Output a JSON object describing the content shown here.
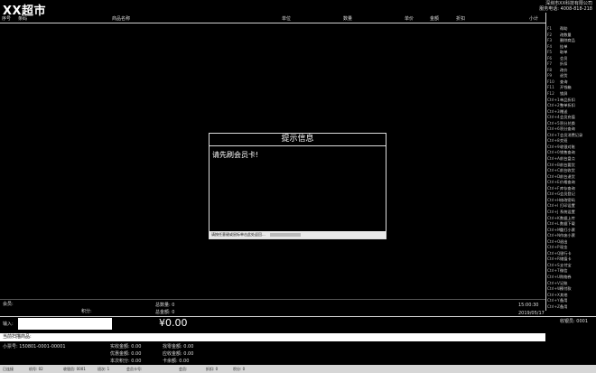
{
  "header": {
    "store_name": "XX超市",
    "company_line1": "深圳市XX科技有限公司",
    "company_line2": "服务电话: 4008-818-218"
  },
  "columns": [
    "序号",
    "条码",
    "商品名称",
    "单位",
    "数量",
    "单价",
    "金额",
    "折扣",
    "小计"
  ],
  "function_keys": [
    {
      "key": "F1",
      "label": "帮助"
    },
    {
      "key": "F2",
      "label": "改数量"
    },
    {
      "key": "F3",
      "label": "删除商品"
    },
    {
      "key": "F4",
      "label": "挂单"
    },
    {
      "key": "F5",
      "label": "取单"
    },
    {
      "key": "F6",
      "label": "会员"
    },
    {
      "key": "F7",
      "label": "折扣"
    },
    {
      "key": "F8",
      "label": "改价"
    },
    {
      "key": "F9",
      "label": "退货"
    },
    {
      "key": "F10",
      "label": "查询"
    },
    {
      "key": "F11",
      "label": "开钱箱"
    },
    {
      "key": "F12",
      "label": "锁屏"
    },
    {
      "key": "Ctrl+1",
      "label": "单品折扣"
    },
    {
      "key": "Ctrl+2",
      "label": "整单折扣"
    },
    {
      "key": "Ctrl+3",
      "label": "赠送"
    },
    {
      "key": "Ctrl+4",
      "label": "会员充值"
    },
    {
      "key": "Ctrl+5",
      "label": "积分兑换"
    },
    {
      "key": "Ctrl+6",
      "label": "积分查询"
    },
    {
      "key": "Ctrl+7",
      "label": "会员消费记录"
    },
    {
      "key": "Ctrl+8",
      "label": "交班"
    },
    {
      "key": "Ctrl+9",
      "label": "收银对账"
    },
    {
      "key": "Ctrl+0",
      "label": "销售查询"
    },
    {
      "key": "Ctrl+A",
      "label": "前台盘点"
    },
    {
      "key": "Ctrl+B",
      "label": "前台要货"
    },
    {
      "key": "Ctrl+C",
      "label": "前台收货"
    },
    {
      "key": "Ctrl+D",
      "label": "前台退货"
    },
    {
      "key": "Ctrl+E",
      "label": "价格查询"
    },
    {
      "key": "Ctrl+F",
      "label": "库存查询"
    },
    {
      "key": "Ctrl+G",
      "label": "会员登记"
    },
    {
      "key": "Ctrl+H",
      "label": "修改密码"
    },
    {
      "key": "Ctrl+I",
      "label": "打印设置"
    },
    {
      "key": "Ctrl+J",
      "label": "系统设置"
    },
    {
      "key": "Ctrl+K",
      "label": "数据上传"
    },
    {
      "key": "Ctrl+L",
      "label": "数据下载"
    },
    {
      "key": "Ctrl+M",
      "label": "重打小票"
    },
    {
      "key": "Ctrl+N",
      "label": "作废小票"
    },
    {
      "key": "Ctrl+O",
      "label": "退出"
    },
    {
      "key": "Ctrl+P",
      "label": "现金"
    },
    {
      "key": "Ctrl+Q",
      "label": "银行卡"
    },
    {
      "key": "Ctrl+R",
      "label": "储值卡"
    },
    {
      "key": "Ctrl+S",
      "label": "支付宝"
    },
    {
      "key": "Ctrl+T",
      "label": "微信"
    },
    {
      "key": "Ctrl+U",
      "label": "购物券"
    },
    {
      "key": "Ctrl+V",
      "label": "记账"
    },
    {
      "key": "Ctrl+W",
      "label": "预付款"
    },
    {
      "key": "Ctrl+X",
      "label": "其他"
    },
    {
      "key": "Ctrl+Y",
      "label": "备用"
    },
    {
      "key": "Ctrl+Z",
      "label": "备用"
    }
  ],
  "dialog": {
    "title": "提示信息",
    "message": "请先刷会员卡!",
    "footer": "请按任意键或鼠标单击此处返回..."
  },
  "summary": {
    "left_label1": "会员:",
    "left_label2": "积分:",
    "mid_label1": "总数量: 0",
    "mid_label2": "总金额: 0",
    "time": "15:00:30",
    "date": "2019/05/17"
  },
  "input": {
    "label": "输入:",
    "value": ""
  },
  "total": "¥0.00",
  "cashier_info": "收银员: 0001",
  "scan_hint": "当前扫描商品:",
  "receipt": {
    "no_label": "小票号: 150801-0001-00001",
    "paid": "实收金额: 0.00",
    "change": "找零金额: 0.00",
    "discount": "优惠金额: 0.00",
    "total_due": "应收金额: 0.00",
    "points": "本次积分: 0.00",
    "balance": "卡余额: 0.00"
  },
  "status_bar": [
    "已连接",
    "机号: 02",
    "收银员: 0001",
    "班次: 1",
    "会员卡号:",
    "会员:",
    "折扣: 0",
    "积分: 0"
  ]
}
